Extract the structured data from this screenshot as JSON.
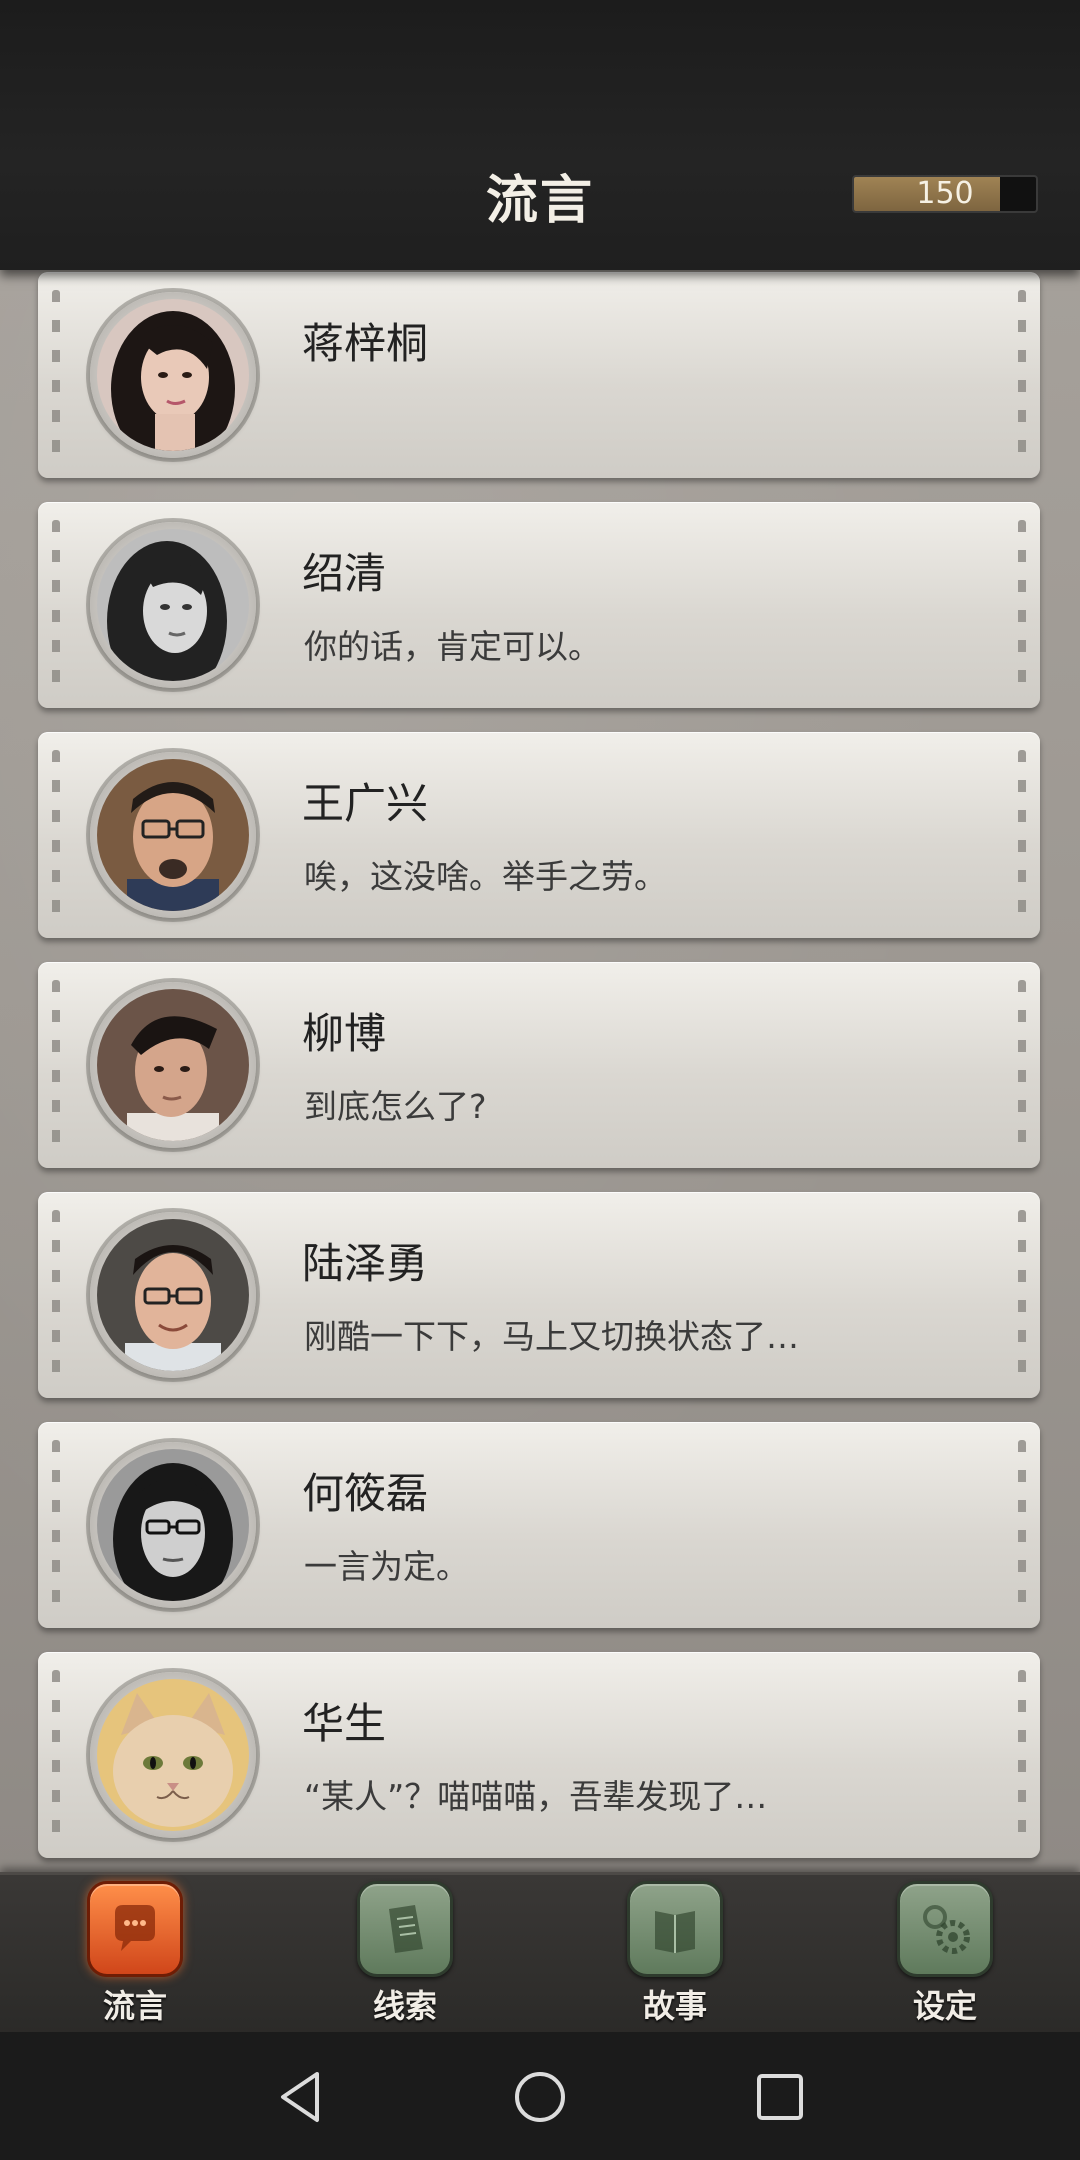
{
  "header": {
    "title": "流言",
    "energy_value": "150",
    "energy_level": 0.8
  },
  "rumors": [
    {
      "name": "蒋梓桐",
      "message": "",
      "avatar": "woman-long-hair-portrait"
    },
    {
      "name": "绍清",
      "message": "你的话，肯定可以。",
      "avatar": "woman-grayscale-portrait"
    },
    {
      "name": "王广兴",
      "message": "唉，这没啥。举手之劳。",
      "avatar": "man-glasses-goatee-portrait"
    },
    {
      "name": "柳博",
      "message": "到底怎么了?",
      "avatar": "man-slicked-hair-portrait"
    },
    {
      "name": "陆泽勇",
      "message": "刚酷一下下，马上又切换状态了…",
      "avatar": "man-glasses-smiling-portrait"
    },
    {
      "name": "何筱磊",
      "message": "一言为定。",
      "avatar": "man-long-hair-glasses-portrait"
    },
    {
      "name": "华生",
      "message": "“某人”？喵喵喵，吾辈发现了…",
      "avatar": "cat-portrait"
    }
  ],
  "tabs": [
    {
      "label": "流言",
      "icon": "chat-bubble-icon",
      "active": true
    },
    {
      "label": "线索",
      "icon": "document-icon",
      "active": false
    },
    {
      "label": "故事",
      "icon": "book-icon",
      "active": false
    },
    {
      "label": "设定",
      "icon": "gear-icon",
      "active": false
    }
  ],
  "colors": {
    "active_tab": "#e05a24",
    "inactive_tab": "#6f896b",
    "header_bg": "#1f1f1f",
    "energy_fill": "#8f744a"
  }
}
